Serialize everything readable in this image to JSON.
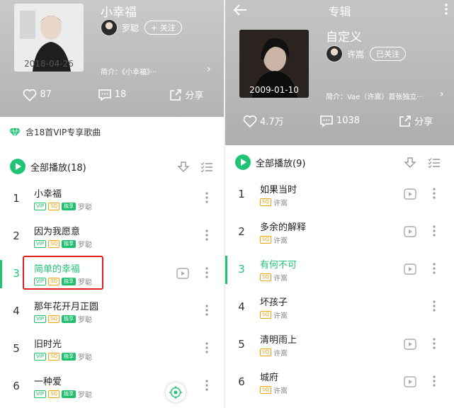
{
  "left": {
    "album_title": "小幸福",
    "cover_date": "2018-04-26",
    "artist": "罗聪",
    "follow_label": "+ 关注",
    "intro": "简介：《小幸福》···",
    "likes": "87",
    "comments": "18",
    "share_label": "分享",
    "vip_banner": "含18首VIP专享歌曲",
    "play_all": "全部播放(18)",
    "songs": [
      {
        "num": "1",
        "title": "小幸福",
        "artist": "罗聪",
        "tags": [
          "VIP",
          "SQ",
          "独享"
        ]
      },
      {
        "num": "2",
        "title": "因为我愿意",
        "artist": "罗聪",
        "tags": [
          "VIP",
          "SQ",
          "独享"
        ]
      },
      {
        "num": "3",
        "title": "简单的幸福",
        "artist": "罗聪",
        "tags": [
          "VIP",
          "SQ",
          "独享"
        ]
      },
      {
        "num": "4",
        "title": "那年花开月正圆",
        "artist": "罗聪",
        "tags": [
          "VIP",
          "SQ",
          "独享"
        ]
      },
      {
        "num": "5",
        "title": "旧时光",
        "artist": "罗聪",
        "tags": [
          "VIP",
          "SQ",
          "独享"
        ]
      },
      {
        "num": "6",
        "title": "一种爱",
        "artist": "罗聪",
        "tags": [
          "VIP",
          "SQ",
          "独享"
        ]
      }
    ]
  },
  "right": {
    "nav_title": "专辑",
    "album_title": "自定义",
    "cover_date": "2009-01-10",
    "artist": "许嵩",
    "follow_label": "已关注",
    "intro": "简介：Vae（许嵩）首张独立···",
    "likes": "4.7万",
    "comments": "1038",
    "share_label": "分享",
    "play_all": "全部播放(9)",
    "songs": [
      {
        "num": "1",
        "title": "如果当时",
        "artist": "许嵩",
        "tags": [
          "SQ"
        ]
      },
      {
        "num": "2",
        "title": "多余的解释",
        "artist": "许嵩",
        "tags": [
          "SQ"
        ]
      },
      {
        "num": "3",
        "title": "有何不可",
        "artist": "许嵩",
        "tags": [
          "SQ"
        ]
      },
      {
        "num": "4",
        "title": "坏孩子",
        "artist": "许嵩",
        "tags": [
          "SQ"
        ]
      },
      {
        "num": "5",
        "title": "清明雨上",
        "artist": "许嵩",
        "tags": [
          "SQ"
        ]
      },
      {
        "num": "6",
        "title": "城府",
        "artist": "许嵩",
        "tags": [
          "SQ"
        ]
      }
    ]
  },
  "colors": {
    "accent": "#21c474",
    "sq": "#f3a20c",
    "highlight_box": "#e02020"
  }
}
